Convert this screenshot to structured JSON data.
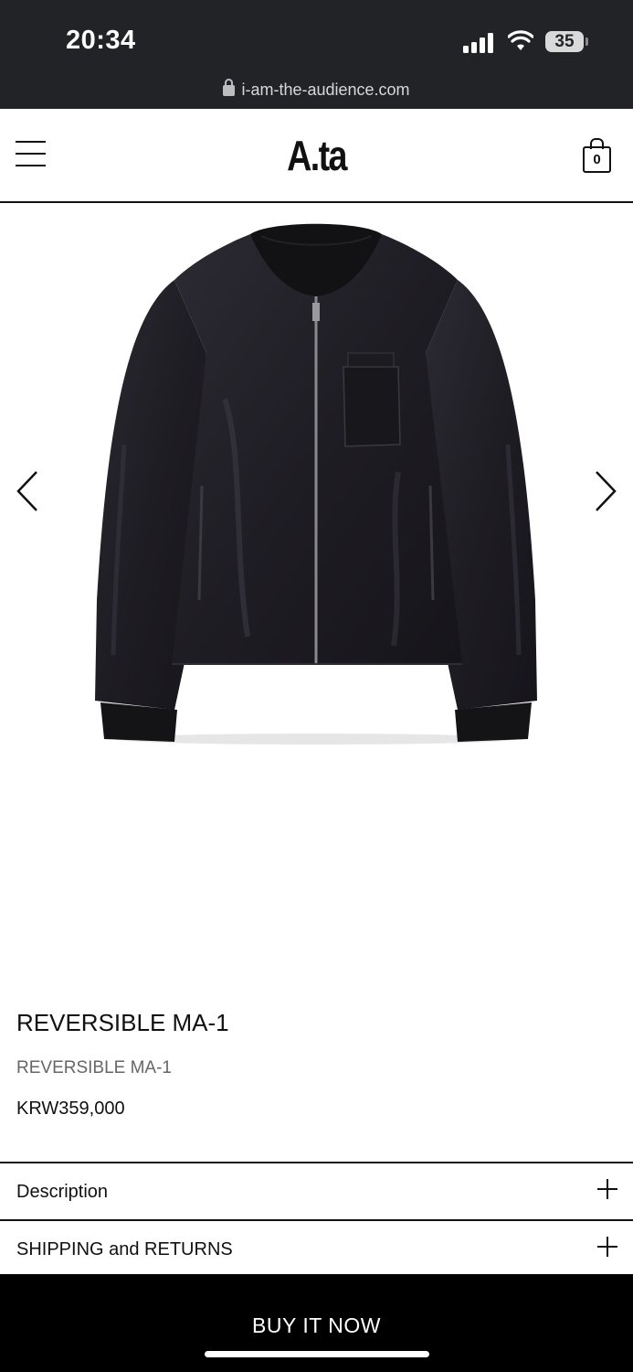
{
  "status": {
    "time": "20:34",
    "battery": "35",
    "signal_icon": "signal-icon",
    "wifi_icon": "wifi-icon"
  },
  "browser": {
    "url": "i-am-the-audience.com",
    "lock_icon": "lock-icon"
  },
  "header": {
    "logo": "A.ta",
    "cart_count": "0",
    "menu_icon": "hamburger-icon",
    "cart_icon": "shopping-bag-icon"
  },
  "carousel": {
    "prev_icon": "chevron-left-icon",
    "next_icon": "chevron-right-icon",
    "image": "black-reversible-bomber-jacket"
  },
  "product": {
    "title": "REVERSIBLE MA-1",
    "subtitle": "REVERSIBLE MA-1",
    "price": "KRW359,000"
  },
  "accordion": [
    {
      "label": "Description"
    },
    {
      "label": "SHIPPING and RETURNS"
    }
  ],
  "cta": {
    "label": "BUY IT NOW"
  },
  "colors": {
    "status_bg": "#222326",
    "text": "#111111",
    "muted": "#666666",
    "cta_bg": "#000000"
  }
}
